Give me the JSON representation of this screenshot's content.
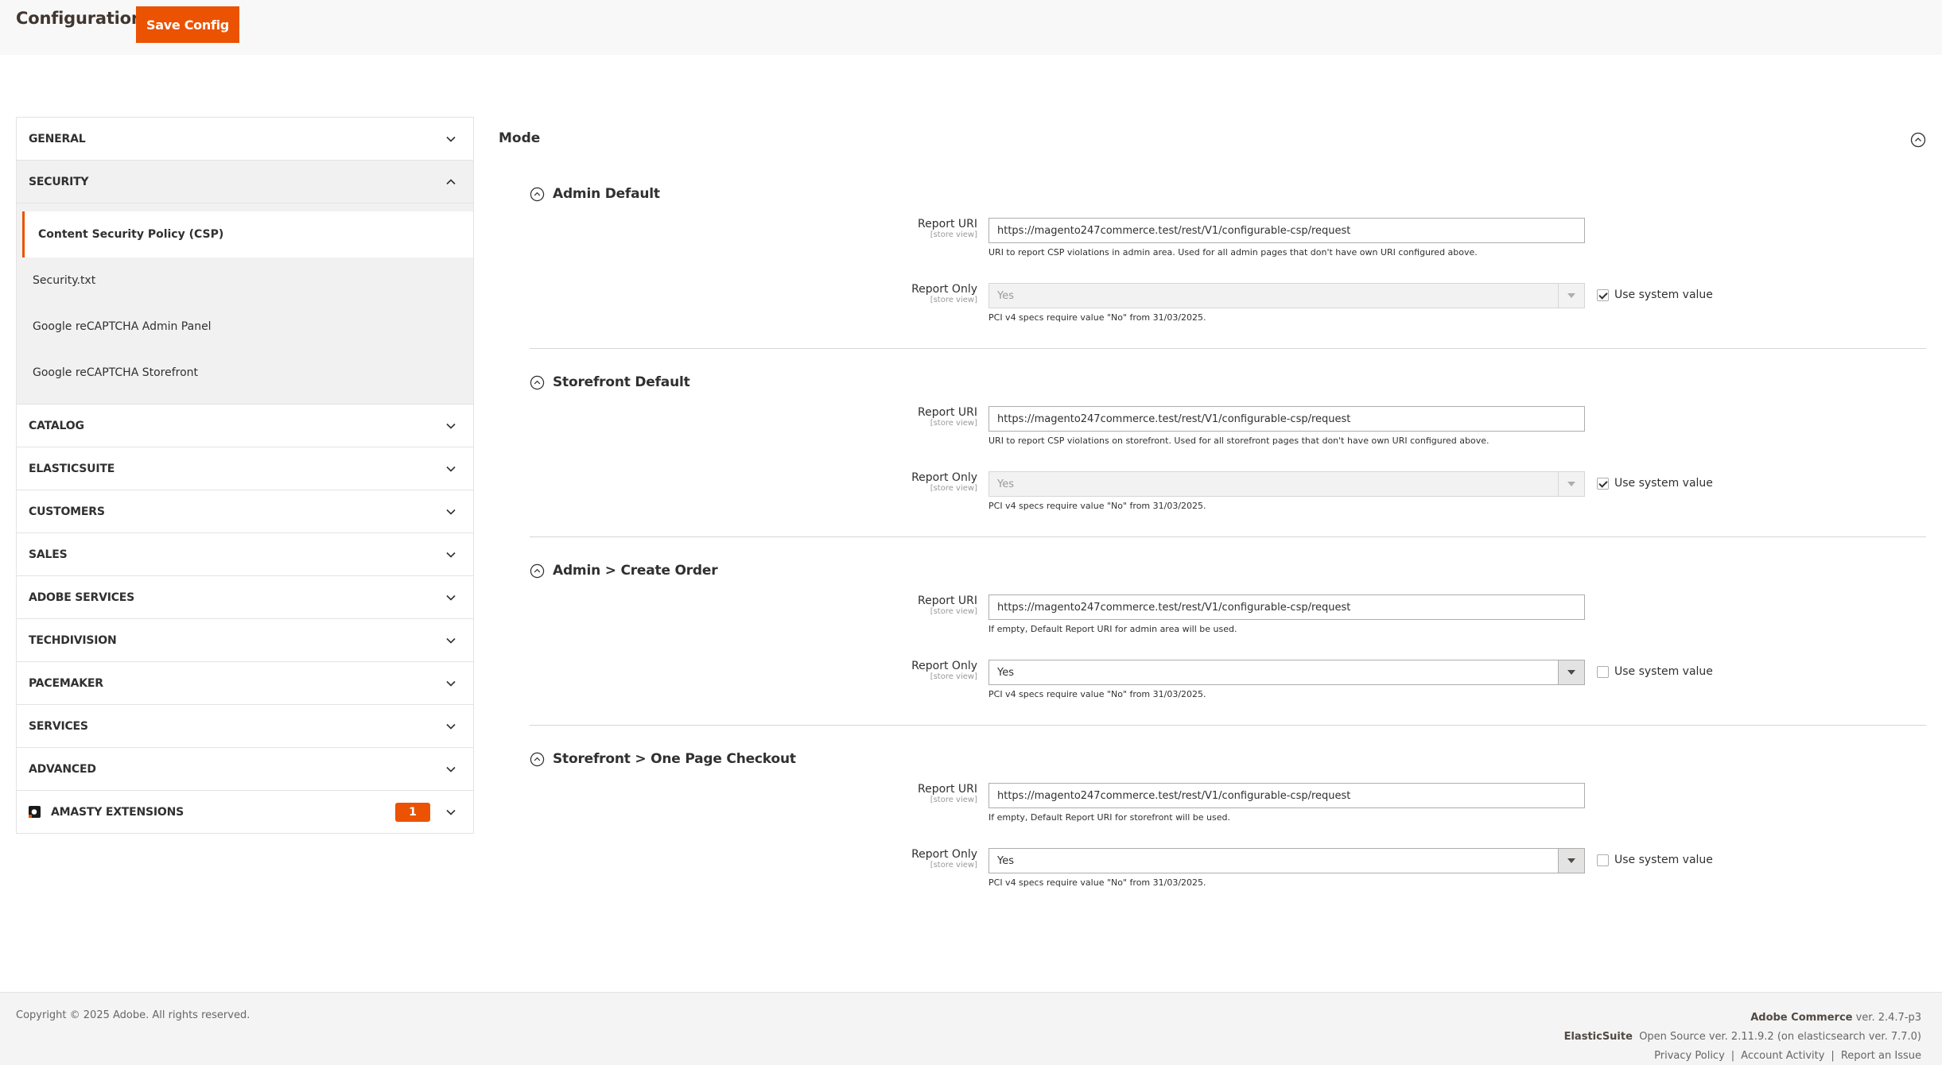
{
  "header": {
    "title": "Configuration",
    "save_label": "Save Config"
  },
  "colors": {
    "accent": "#eb5202",
    "active_bg": "#f1f1f1"
  },
  "sidebar": {
    "general": {
      "label": "GENERAL",
      "expanded": false
    },
    "security": {
      "label": "SECURITY",
      "expanded": true,
      "items": [
        {
          "label": "Content Security Policy (CSP)",
          "active": true
        },
        {
          "label": "Security.txt",
          "active": false
        },
        {
          "label": "Google reCAPTCHA Admin Panel",
          "active": false
        },
        {
          "label": "Google reCAPTCHA Storefront",
          "active": false
        }
      ]
    },
    "tabs": [
      {
        "label": "CATALOG"
      },
      {
        "label": "ELASTICSUITE"
      },
      {
        "label": "CUSTOMERS"
      },
      {
        "label": "SALES"
      },
      {
        "label": "ADOBE SERVICES"
      },
      {
        "label": "TECHDIVISION"
      },
      {
        "label": "PACEMAKER"
      },
      {
        "label": "SERVICES"
      },
      {
        "label": "ADVANCED"
      }
    ],
    "amasty": {
      "label": "AMASTY EXTENSIONS",
      "badge": "1"
    }
  },
  "main": {
    "section_title": "Mode",
    "groups": [
      {
        "title": "Admin Default",
        "report_uri": {
          "label": "Report URI",
          "scope": "[store view]",
          "value": "https://magento247commerce.test/rest/V1/configurable-csp/request",
          "note": "URI to report CSP violations in admin area. Used for all admin pages that don't have own URI configured above."
        },
        "report_only": {
          "label": "Report Only",
          "scope": "[store view]",
          "value": "Yes",
          "disabled": true,
          "note": "PCI v4 specs require value \"No\" from 31/03/2025.",
          "use_system_value": true,
          "use_system_label": "Use system value"
        }
      },
      {
        "title": "Storefront Default",
        "report_uri": {
          "label": "Report URI",
          "scope": "[store view]",
          "value": "https://magento247commerce.test/rest/V1/configurable-csp/request",
          "note": "URI to report CSP violations on storefront. Used for all storefront pages that don't have own URI configured above."
        },
        "report_only": {
          "label": "Report Only",
          "scope": "[store view]",
          "value": "Yes",
          "disabled": true,
          "note": "PCI v4 specs require value \"No\" from 31/03/2025.",
          "use_system_value": true,
          "use_system_label": "Use system value"
        }
      },
      {
        "title": "Admin > Create Order",
        "report_uri": {
          "label": "Report URI",
          "scope": "[store view]",
          "value": "https://magento247commerce.test/rest/V1/configurable-csp/request",
          "note": "If empty, Default Report URI for admin area will be used."
        },
        "report_only": {
          "label": "Report Only",
          "scope": "[store view]",
          "value": "Yes",
          "disabled": false,
          "note": "PCI v4 specs require value \"No\" from 31/03/2025.",
          "use_system_value": false,
          "use_system_label": "Use system value"
        }
      },
      {
        "title": "Storefront > One Page Checkout",
        "report_uri": {
          "label": "Report URI",
          "scope": "[store view]",
          "value": "https://magento247commerce.test/rest/V1/configurable-csp/request",
          "note": "If empty, Default Report URI for storefront will be used."
        },
        "report_only": {
          "label": "Report Only",
          "scope": "[store view]",
          "value": "Yes",
          "disabled": false,
          "note": "PCI v4 specs require value \"No\" from 31/03/2025.",
          "use_system_value": false,
          "use_system_label": "Use system value"
        }
      }
    ]
  },
  "footer": {
    "copyright": "Copyright © 2025 Adobe. All rights reserved.",
    "product_name": "Adobe Commerce",
    "product_version": " ver. 2.4.7-p3",
    "elasticsuite_name": "ElasticSuite",
    "elasticsuite_version": "Open Source ver. 2.11.9.2 (on elasticsearch ver. 7.7.0)",
    "links": [
      "Privacy Policy",
      "Account Activity",
      "Report an Issue"
    ]
  }
}
